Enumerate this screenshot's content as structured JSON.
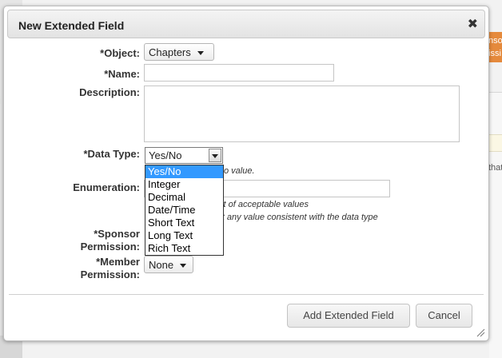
{
  "dialog": {
    "title": "New Extended Field",
    "close_glyph": "✖",
    "close_icon": "close-icon"
  },
  "form": {
    "object_label": "*Object:",
    "object_value": "Chapters",
    "name_label": "*Name:",
    "name_value": "",
    "description_label": "Description:",
    "description_value": "",
    "datatype_label": "*Data Type:",
    "datatype_value": "Yes/No",
    "datatype_hint_tail": "o value.",
    "datatype_options": [
      "Yes/No",
      "Integer",
      "Decimal",
      "Date/Time",
      "Short Text",
      "Long Text",
      "Rich Text"
    ],
    "datatype_selected_index": 0,
    "enumeration_label": "Enumeration:",
    "enumeration_value": "",
    "enum_hint1_tail": "d list of acceptable values",
    "enum_hint2_tail": "cept any value consistent with the data type",
    "sponsor_label_1": "*Sponsor",
    "sponsor_label_2": "Permission:",
    "member_label_1": "*Member",
    "member_label_2": "Permission:",
    "member_value": "None"
  },
  "buttons": {
    "add_label": "Add Extended Field",
    "cancel_label": "Cancel"
  },
  "background": {
    "orange_text_1": "nso",
    "orange_text_2": "issi",
    "right_text": "that",
    "left_char": "i"
  },
  "colors": {
    "selection": "#3399ff",
    "accent_orange": "#e58a3c"
  }
}
